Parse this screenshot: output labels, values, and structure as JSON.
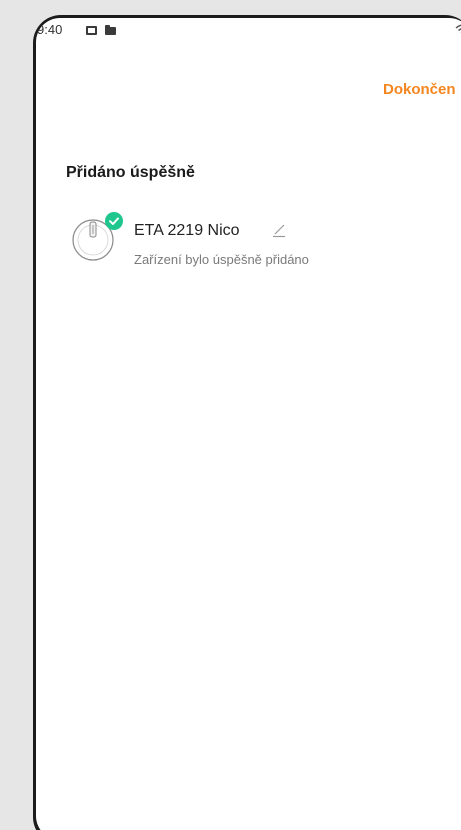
{
  "status_bar": {
    "time": "9:40"
  },
  "header": {
    "finish_label": "Dokončen"
  },
  "main": {
    "title": "Přidáno úspěšně",
    "device": {
      "name": "ETA 2219 Nico",
      "status": "Zařízení bylo úspěšně přidáno"
    }
  },
  "colors": {
    "accent": "#f5861f",
    "success": "#1fc78f"
  }
}
